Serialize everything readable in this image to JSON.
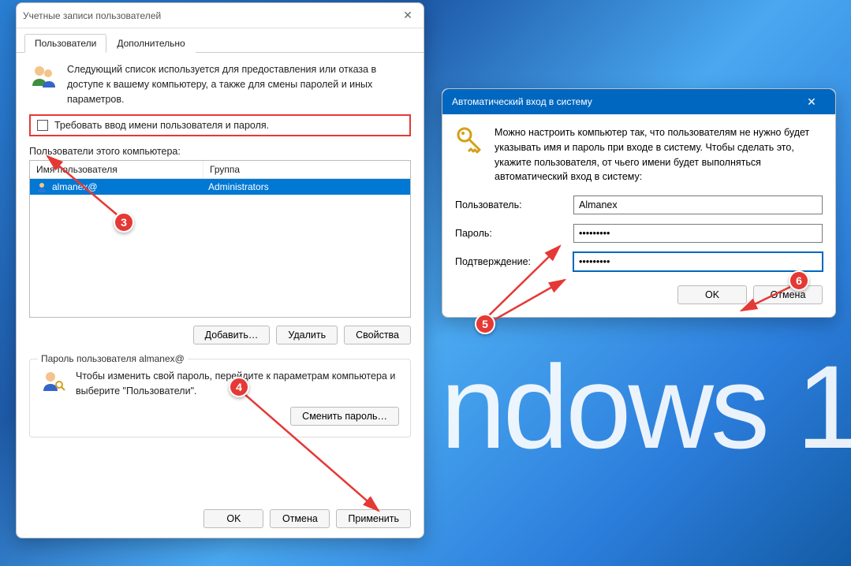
{
  "background_text": "ndows 1",
  "main": {
    "title": "Учетные записи пользователей",
    "tabs": [
      {
        "label": "Пользователи",
        "active": true
      },
      {
        "label": "Дополнительно",
        "active": false
      }
    ],
    "description": "Следующий список используется для предоставления или отказа в доступе к вашему компьютеру, а также для смены паролей и иных параметров.",
    "checkbox_label": "Требовать ввод имени пользователя и пароля.",
    "users_label": "Пользователи этого компьютера:",
    "columns": {
      "user": "Имя пользователя",
      "group": "Группа"
    },
    "rows": [
      {
        "user": "almanex@",
        "group": "Administrators",
        "selected": true
      }
    ],
    "buttons": {
      "add": "Добавить…",
      "remove": "Удалить",
      "props": "Свойства"
    },
    "password_group": {
      "title": "Пароль пользователя almanex@",
      "text": "Чтобы изменить свой пароль, перейдите к параметрам компьютера и выберите \"Пользователи\".",
      "change_btn": "Сменить пароль…"
    },
    "footer": {
      "ok": "OK",
      "cancel": "Отмена",
      "apply": "Применить"
    }
  },
  "login": {
    "title": "Автоматический вход в систему",
    "description": "Можно настроить компьютер так, что пользователям не нужно будет указывать имя и пароль при входе в систему. Чтобы сделать это, укажите пользователя, от чьего имени будет выполняться автоматический вход в систему:",
    "labels": {
      "user": "Пользователь:",
      "password": "Пароль:",
      "confirm": "Подтверждение:"
    },
    "values": {
      "user": "Almanex",
      "password": "•••••••••",
      "confirm": "•••••••••"
    },
    "buttons": {
      "ok": "OK",
      "cancel": "Отмена"
    }
  },
  "annotations": {
    "b3": "3",
    "b4": "4",
    "b5": "5",
    "b6": "6"
  }
}
